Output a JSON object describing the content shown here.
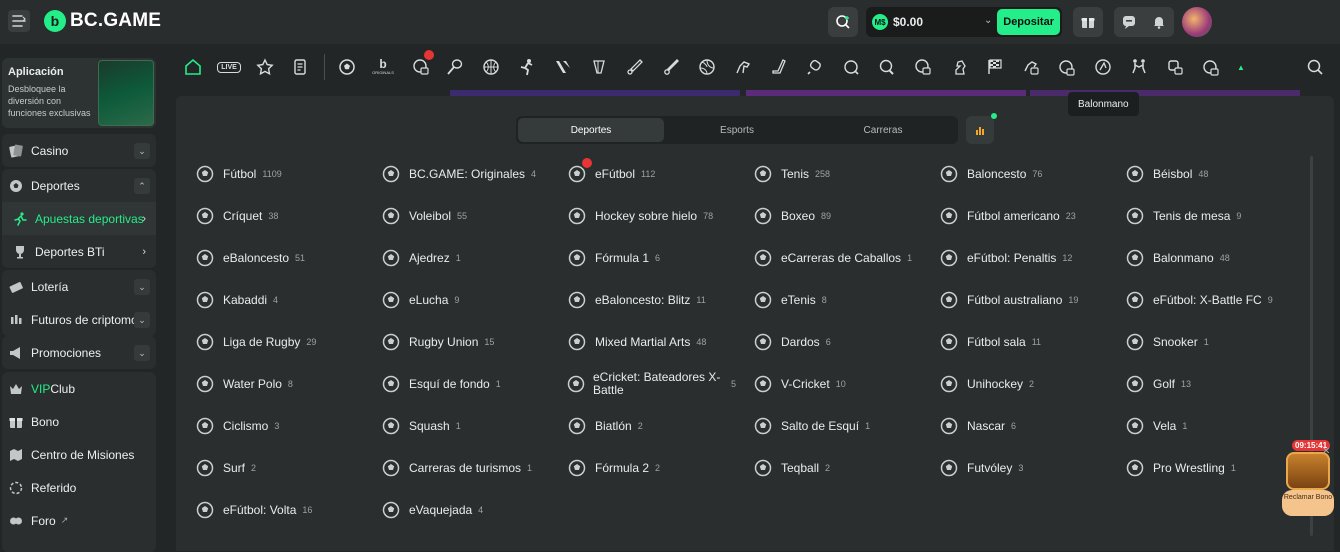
{
  "header": {
    "logo_text": "BC.GAME",
    "balance": "$0.00",
    "coin_label": "M$",
    "deposit_label": "Depositar"
  },
  "sidebar": {
    "app_title": "Aplicación",
    "app_text": "Desbloquee la diversión con funciones exclusivas",
    "items": [
      {
        "label": "Casino"
      },
      {
        "label": "Deportes"
      },
      {
        "label": "Apuestas deportivas"
      },
      {
        "label": "Deportes BTi"
      },
      {
        "label": "Lotería"
      },
      {
        "label": "Futuros de criptomon"
      },
      {
        "label": "Promociones"
      },
      {
        "label_prefix": "VIP",
        "label": " Club"
      },
      {
        "label": "Bono"
      },
      {
        "label": "Centro de Misiones"
      },
      {
        "label": "Referido"
      },
      {
        "label": "Foro"
      }
    ]
  },
  "sportsbar": {
    "live_label": "LIVE",
    "originals_label": "ORIGINALS",
    "tooltip": "Balonmano"
  },
  "panel": {
    "tabs": [
      {
        "label": "Deportes",
        "active": true
      },
      {
        "label": "Esports",
        "active": false
      },
      {
        "label": "Carreras",
        "active": false
      }
    ],
    "columns": [
      [
        {
          "label": "Fútbol",
          "count": "1109",
          "icon": "soccer-icon"
        },
        {
          "label": "Críquet",
          "count": "38",
          "icon": "cricket-icon"
        },
        {
          "label": "eBaloncesto",
          "count": "51",
          "icon": "ebasketball-icon"
        },
        {
          "label": "Kabaddi",
          "count": "4",
          "icon": "kabaddi-icon"
        },
        {
          "label": "Liga de Rugby",
          "count": "29",
          "icon": "rugby-league-icon"
        },
        {
          "label": "Water Polo",
          "count": "8",
          "icon": "water-polo-icon"
        },
        {
          "label": "Ciclismo",
          "count": "3",
          "icon": "cycling-icon"
        },
        {
          "label": "Surf",
          "count": "2",
          "icon": "surf-icon"
        },
        {
          "label": "eFútbol: Volta",
          "count": "16",
          "icon": "efootball-volta-icon"
        }
      ],
      [
        {
          "label": "BC.GAME: Originales",
          "count": "4",
          "icon": "originals-icon"
        },
        {
          "label": "Voleibol",
          "count": "55",
          "icon": "volleyball-icon"
        },
        {
          "label": "Ajedrez",
          "count": "1",
          "icon": "chess-icon"
        },
        {
          "label": "eLucha",
          "count": "9",
          "icon": "efighting-icon"
        },
        {
          "label": "Rugby Union",
          "count": "15",
          "icon": "rugby-union-icon"
        },
        {
          "label": "Esquí de fondo",
          "count": "1",
          "icon": "cross-country-ski-icon"
        },
        {
          "label": "Squash",
          "count": "1",
          "icon": "squash-icon"
        },
        {
          "label": "Carreras de turismos",
          "count": "1",
          "icon": "touring-cars-icon"
        },
        {
          "label": "eVaquejada",
          "count": "4",
          "icon": "evaquejada-icon"
        }
      ],
      [
        {
          "label": "eFútbol",
          "count": "112",
          "icon": "efootball-icon"
        },
        {
          "label": "Hockey sobre hielo",
          "count": "78",
          "icon": "ice-hockey-icon"
        },
        {
          "label": "Fórmula 1",
          "count": "6",
          "icon": "formula1-icon"
        },
        {
          "label": "eBaloncesto: Blitz",
          "count": "11",
          "icon": "ebasketball-blitz-icon"
        },
        {
          "label": "Mixed Martial Arts",
          "count": "48",
          "icon": "mma-icon"
        },
        {
          "label": "eCricket: Bateadores X-Battle",
          "count": "5",
          "icon": "ecricket-icon"
        },
        {
          "label": "Biatlón",
          "count": "2",
          "icon": "biathlon-icon"
        },
        {
          "label": "Fórmula 2",
          "count": "2",
          "icon": "formula2-icon"
        }
      ],
      [
        {
          "label": "Tenis",
          "count": "258",
          "icon": "tennis-icon"
        },
        {
          "label": "Boxeo",
          "count": "89",
          "icon": "boxing-icon"
        },
        {
          "label": "eCarreras de Caballos",
          "count": "1",
          "icon": "ehorse-racing-icon"
        },
        {
          "label": "eTenis",
          "count": "8",
          "icon": "etennis-icon"
        },
        {
          "label": "Dardos",
          "count": "6",
          "icon": "darts-icon"
        },
        {
          "label": "V-Cricket",
          "count": "10",
          "icon": "v-cricket-icon"
        },
        {
          "label": "Salto de Esquí",
          "count": "1",
          "icon": "ski-jumping-icon"
        },
        {
          "label": "Teqball",
          "count": "2",
          "icon": "teqball-icon"
        }
      ],
      [
        {
          "label": "Baloncesto",
          "count": "76",
          "icon": "basketball-icon"
        },
        {
          "label": "Fútbol americano",
          "count": "23",
          "icon": "american-football-icon"
        },
        {
          "label": "eFútbol: Penaltis",
          "count": "12",
          "icon": "efootball-penalty-icon"
        },
        {
          "label": "Fútbol australiano",
          "count": "19",
          "icon": "aussie-rules-icon"
        },
        {
          "label": "Fútbol sala",
          "count": "11",
          "icon": "futsal-icon"
        },
        {
          "label": "Unihockey",
          "count": "2",
          "icon": "floorball-icon"
        },
        {
          "label": "Nascar",
          "count": "6",
          "icon": "nascar-icon"
        },
        {
          "label": "Futvóley",
          "count": "3",
          "icon": "footvolley-icon"
        }
      ],
      [
        {
          "label": "Béisbol",
          "count": "48",
          "icon": "baseball-icon"
        },
        {
          "label": "Tenis de mesa",
          "count": "9",
          "icon": "table-tennis-icon"
        },
        {
          "label": "Balonmano",
          "count": "48",
          "icon": "handball-icon"
        },
        {
          "label": "eFútbol: X-Battle FC",
          "count": "9",
          "icon": "efootball-xbattle-icon"
        },
        {
          "label": "Snooker",
          "count": "1",
          "icon": "snooker-icon"
        },
        {
          "label": "Golf",
          "count": "13",
          "icon": "golf-icon"
        },
        {
          "label": "Vela",
          "count": "1",
          "icon": "sailing-icon"
        },
        {
          "label": "Pro Wrestling",
          "count": "1",
          "icon": "wrestling-icon"
        }
      ]
    ]
  },
  "claim": {
    "timer": "09:15:41",
    "label": "Reclamar Bono"
  },
  "colors": {
    "accent": "#24ee89",
    "background": "#232626",
    "panel": "#2a2e2e",
    "hot": "#e53535"
  }
}
